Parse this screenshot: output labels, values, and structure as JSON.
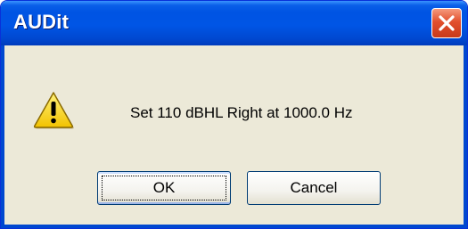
{
  "dialog": {
    "title": "AUDit",
    "message": "Set 110 dBHL Right at 1000.0 Hz",
    "icon": "warning-icon",
    "buttons": {
      "ok_label": "OK",
      "cancel_label": "Cancel"
    },
    "close_icon": "close-icon"
  },
  "colors": {
    "titlebar": "#0054e3",
    "dialog_background": "#ece9d8",
    "close_button": "#e2502d",
    "warning_fill": "#ffd800"
  }
}
